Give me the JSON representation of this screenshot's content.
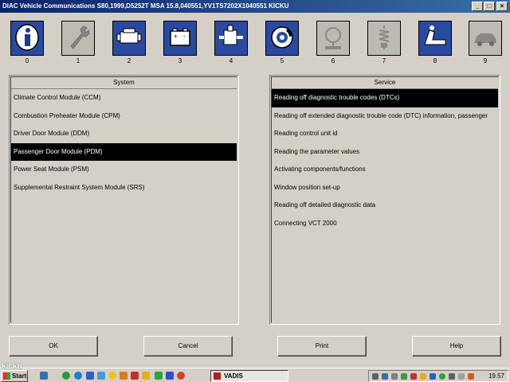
{
  "window": {
    "title": "DIAC  Vehicle Communications S80,1999,D5252T MSA 15.8,040551,YV1TS7202X1040551 KICKU",
    "controls": [
      "_",
      "□",
      "×"
    ]
  },
  "toolbar": {
    "tools": [
      {
        "num": "0",
        "icon": "info-icon",
        "state": "on"
      },
      {
        "num": "1",
        "icon": "wrench-icon",
        "state": "off"
      },
      {
        "num": "2",
        "icon": "engine-icon",
        "state": "on"
      },
      {
        "num": "3",
        "icon": "battery-icon",
        "state": "on"
      },
      {
        "num": "4",
        "icon": "gearbox-icon",
        "state": "on"
      },
      {
        "num": "5",
        "icon": "brake-icon",
        "state": "on"
      },
      {
        "num": "6",
        "icon": "steering-icon",
        "state": "off"
      },
      {
        "num": "7",
        "icon": "suspension-icon",
        "state": "off"
      },
      {
        "num": "8",
        "icon": "seat-icon",
        "state": "on"
      },
      {
        "num": "9",
        "icon": "car-body-icon",
        "state": "off"
      }
    ]
  },
  "system": {
    "header": "System",
    "items": [
      "Climate Control Module (CCM)",
      "Combustion Preheater Module (CPM)",
      "Driver Door Module (DDM)",
      "Passenger Door Module (PDM)",
      "Power Seat Module (PSM)",
      "Supplemental Restraint System Module (SRS)"
    ],
    "selected": 3
  },
  "service": {
    "header": "Service",
    "items": [
      "Reading off diagnostic trouble codes (DTCs)",
      "Reading off extended diagnostic trouble code (DTC) information, passenger",
      "Reading control unit id",
      "Reading the parameter values",
      "Activating components/functions",
      "Window position set-up",
      "Reading off detailed diagnostic data",
      "Connecting VCT 2000"
    ],
    "selected": 0
  },
  "buttons": {
    "ok": "OK",
    "cancel": "Cancel",
    "print": "Print",
    "help": "Help"
  },
  "taskbar": {
    "start": "Start",
    "task": "VADIS",
    "clock": "19.57",
    "watermark": "kicku"
  },
  "colors": {
    "title_start": "#0a246a",
    "title_end": "#3a6ea5",
    "tool_on": "#2a4aa0",
    "tool_off": "#bdbab4",
    "selection": "#000000"
  }
}
